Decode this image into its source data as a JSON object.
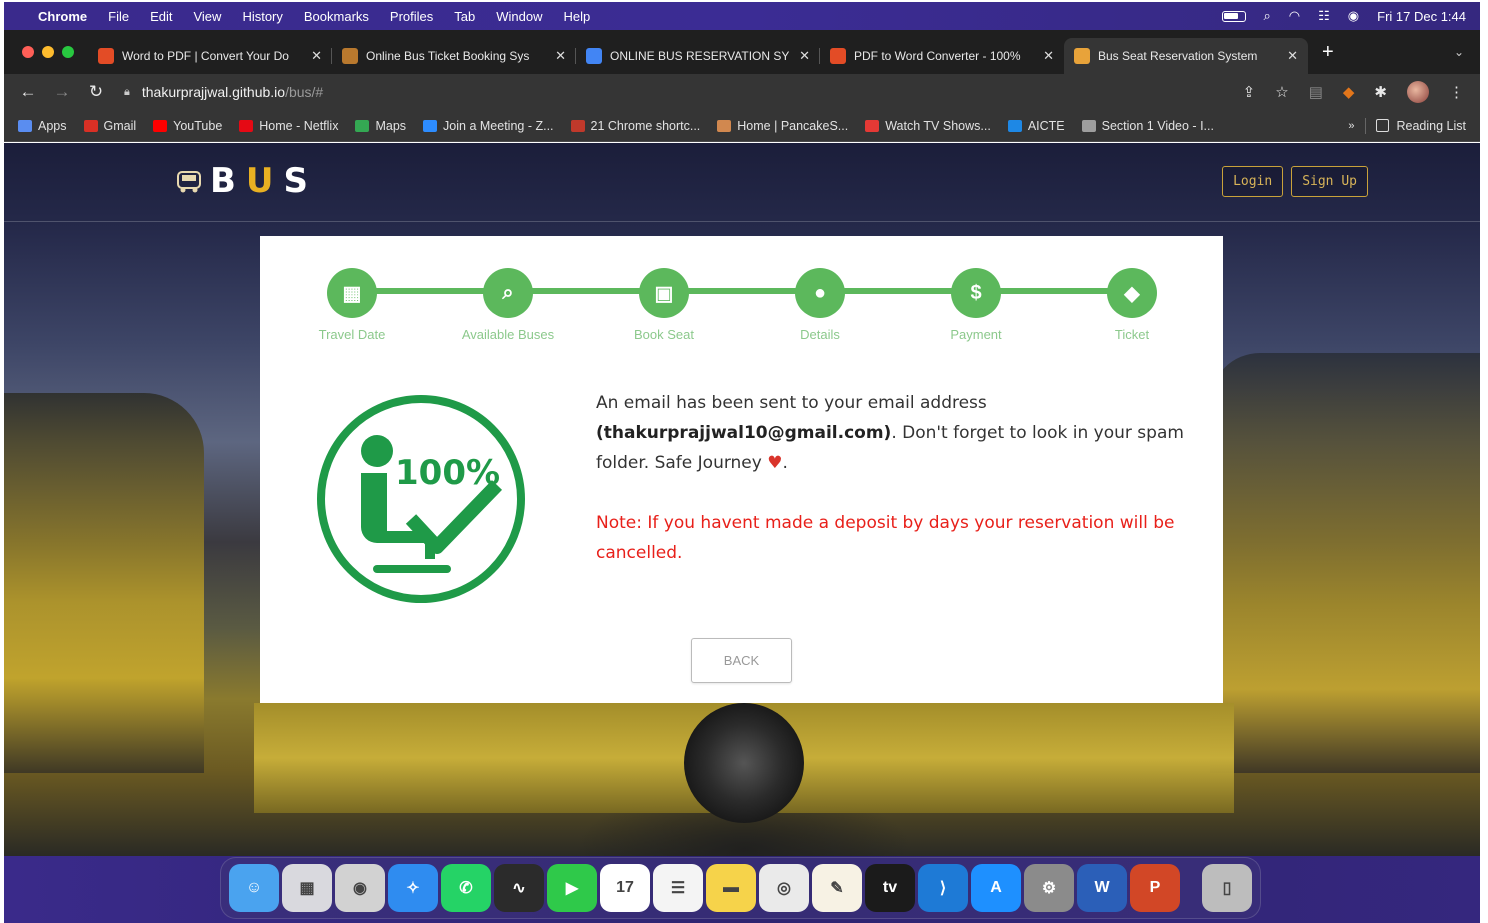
{
  "menubar": {
    "app": "Chrome",
    "items": [
      "File",
      "Edit",
      "View",
      "History",
      "Bookmarks",
      "Profiles",
      "Tab",
      "Window",
      "Help"
    ],
    "datetime": "Fri 17 Dec  1:44"
  },
  "tabs": [
    {
      "title": "Word to PDF | Convert Your Do",
      "color": "#e34c26"
    },
    {
      "title": "Online Bus Ticket Booking Sys",
      "color": "#b9792e"
    },
    {
      "title": "ONLINE BUS RESERVATION SY",
      "color": "#4285f4"
    },
    {
      "title": "PDF to Word Converter - 100%",
      "color": "#e34c26"
    },
    {
      "title": "Bus Seat Reservation System",
      "color": "#e8a33a"
    }
  ],
  "address": {
    "host": "thakurprajjwal.github.io",
    "path": "/bus/#"
  },
  "bookmarks": [
    {
      "label": "Apps",
      "color": "#5a8df0"
    },
    {
      "label": "Gmail",
      "color": "#d93025"
    },
    {
      "label": "YouTube",
      "color": "#ff0000"
    },
    {
      "label": "Home - Netflix",
      "color": "#e50914"
    },
    {
      "label": "Maps",
      "color": "#34a853"
    },
    {
      "label": "Join a Meeting - Z...",
      "color": "#2d8cff"
    },
    {
      "label": "21 Chrome shortc...",
      "color": "#c0392b"
    },
    {
      "label": "Home | PancakeS...",
      "color": "#d1884f"
    },
    {
      "label": "Watch TV Shows...",
      "color": "#e53935"
    },
    {
      "label": "AICTE",
      "color": "#1e88e5"
    },
    {
      "label": "Section 1 Video - I...",
      "color": "#9e9e9e"
    }
  ],
  "bookmarks_more": "»",
  "reading_list": "Reading List",
  "site": {
    "logo_b": "B",
    "logo_u": "U",
    "logo_s": "S",
    "login": "Login",
    "signup": "Sign Up"
  },
  "steps": [
    {
      "label": "Travel Date",
      "icon": "calendar-icon",
      "glyph": "▦"
    },
    {
      "label": "Available Buses",
      "icon": "search-icon",
      "glyph": "⌕"
    },
    {
      "label": "Book Seat",
      "icon": "bus-icon",
      "glyph": "▣"
    },
    {
      "label": "Details",
      "icon": "user-icon",
      "glyph": "●"
    },
    {
      "label": "Payment",
      "icon": "dollar-icon",
      "glyph": "$"
    },
    {
      "label": "Ticket",
      "icon": "ticket-icon",
      "glyph": "◆"
    }
  ],
  "confirmation": {
    "badge_text": "100%",
    "line1": "An email has been sent to your email address",
    "email": "(thakurprajjwal10@gmail.com)",
    "line2": ". Don't forget to look in your spam folder. Safe Journey ",
    "heart": "♥",
    "end": ".",
    "note": "Note: If you havent made a deposit by days your reservation will be cancelled."
  },
  "back_label": "BACK",
  "dock": [
    {
      "name": "finder-icon",
      "bg": "#4aa3ef",
      "glyph": "☺"
    },
    {
      "name": "launchpad-icon",
      "bg": "#d9d9de",
      "glyph": "▦"
    },
    {
      "name": "screenshot-icon",
      "bg": "#d2d2d2",
      "glyph": "◉"
    },
    {
      "name": "safari-icon",
      "bg": "#2f8cf0",
      "glyph": "✧"
    },
    {
      "name": "whatsapp-icon",
      "bg": "#25d366",
      "glyph": "✆"
    },
    {
      "name": "activity-monitor-icon",
      "bg": "#2b2b2b",
      "glyph": "∿"
    },
    {
      "name": "facetime-icon",
      "bg": "#2fc94a",
      "glyph": "▶"
    },
    {
      "name": "calendar-icon",
      "bg": "#ffffff",
      "glyph": "17"
    },
    {
      "name": "reminders-icon",
      "bg": "#f4f4f4",
      "glyph": "☰"
    },
    {
      "name": "notes-icon",
      "bg": "#f6d34a",
      "glyph": "▬"
    },
    {
      "name": "chrome-icon",
      "bg": "#eaeaea",
      "glyph": "◎"
    },
    {
      "name": "pages-icon",
      "bg": "#f7f2e4",
      "glyph": "✎"
    },
    {
      "name": "apple-tv-icon",
      "bg": "#1b1b1b",
      "glyph": "tv"
    },
    {
      "name": "vscode-icon",
      "bg": "#1e7ad6",
      "glyph": "⟩"
    },
    {
      "name": "app-store-icon",
      "bg": "#1e90ff",
      "glyph": "A"
    },
    {
      "name": "system-preferences-icon",
      "bg": "#8b8b8b",
      "glyph": "⚙"
    },
    {
      "name": "word-icon",
      "bg": "#2b5fb8",
      "glyph": "W"
    },
    {
      "name": "powerpoint-icon",
      "bg": "#d24726",
      "glyph": "P"
    },
    {
      "name": "trash-icon",
      "bg": "#bdbdbd",
      "glyph": "▯"
    }
  ]
}
